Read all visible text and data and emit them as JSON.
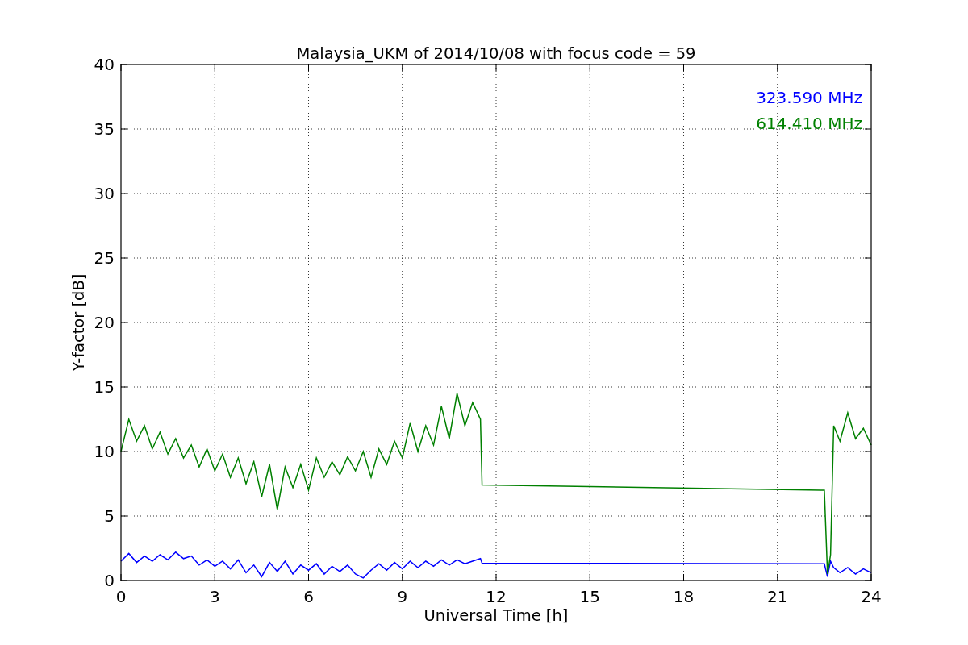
{
  "plot": {
    "chart_data": {
      "type": "line",
      "title": "Malaysia_UKM of 2014/10/08 with focus code = 59",
      "xlabel": "Universal Time [h]",
      "ylabel": "Y-factor [dB]",
      "x": [
        0,
        0.25,
        0.5,
        0.75,
        1,
        1.25,
        1.5,
        1.75,
        2,
        2.25,
        2.5,
        2.75,
        3,
        3.25,
        3.5,
        3.75,
        4,
        4.25,
        4.5,
        4.75,
        5,
        5.25,
        5.5,
        5.75,
        6,
        6.25,
        6.5,
        6.75,
        7,
        7.25,
        7.5,
        7.75,
        8,
        8.25,
        8.5,
        8.75,
        9,
        9.25,
        9.5,
        9.75,
        10,
        10.25,
        10.5,
        10.75,
        11,
        11.25,
        11.5,
        11.55,
        22.5,
        22.6,
        22.7,
        22.8,
        23,
        23.25,
        23.5,
        23.75,
        24
      ],
      "series": [
        {
          "name": "323.590 MHz",
          "color": "#0000ff",
          "values": [
            1.5,
            2.1,
            1.4,
            1.9,
            1.5,
            2.0,
            1.6,
            2.2,
            1.7,
            1.9,
            1.2,
            1.6,
            1.1,
            1.5,
            0.9,
            1.6,
            0.6,
            1.2,
            0.3,
            1.4,
            0.7,
            1.5,
            0.5,
            1.2,
            0.8,
            1.3,
            0.5,
            1.1,
            0.7,
            1.2,
            0.5,
            0.2,
            0.8,
            1.3,
            0.8,
            1.4,
            0.9,
            1.5,
            1.0,
            1.5,
            1.1,
            1.6,
            1.2,
            1.6,
            1.3,
            1.5,
            1.7,
            1.35,
            1.3,
            0.3,
            1.5,
            1.0,
            0.6,
            1.0,
            0.5,
            0.9,
            0.6
          ]
        },
        {
          "name": "614.410 MHz",
          "color": "#008000",
          "values": [
            10.0,
            12.5,
            10.8,
            12.0,
            10.2,
            11.5,
            9.8,
            11.0,
            9.5,
            10.5,
            8.8,
            10.2,
            8.5,
            9.8,
            8.0,
            9.5,
            7.5,
            9.2,
            6.5,
            9.0,
            5.5,
            8.8,
            7.2,
            9.0,
            7.0,
            9.5,
            8.0,
            9.2,
            8.2,
            9.6,
            8.5,
            10.0,
            8.0,
            10.2,
            9.0,
            10.8,
            9.5,
            12.2,
            10.0,
            12.0,
            10.5,
            13.5,
            11.0,
            14.5,
            12.0,
            13.8,
            12.5,
            7.4,
            7.0,
            0.5,
            2.0,
            12.0,
            10.8,
            13.0,
            11.0,
            11.8,
            10.5
          ]
        }
      ],
      "grid": true,
      "xlim": [
        0,
        24
      ],
      "ylim": [
        0,
        40
      ],
      "xticks": [
        0,
        3,
        6,
        9,
        12,
        15,
        18,
        21,
        24
      ],
      "yticks": [
        0,
        5,
        10,
        15,
        20,
        25,
        30,
        35,
        40
      ]
    }
  }
}
